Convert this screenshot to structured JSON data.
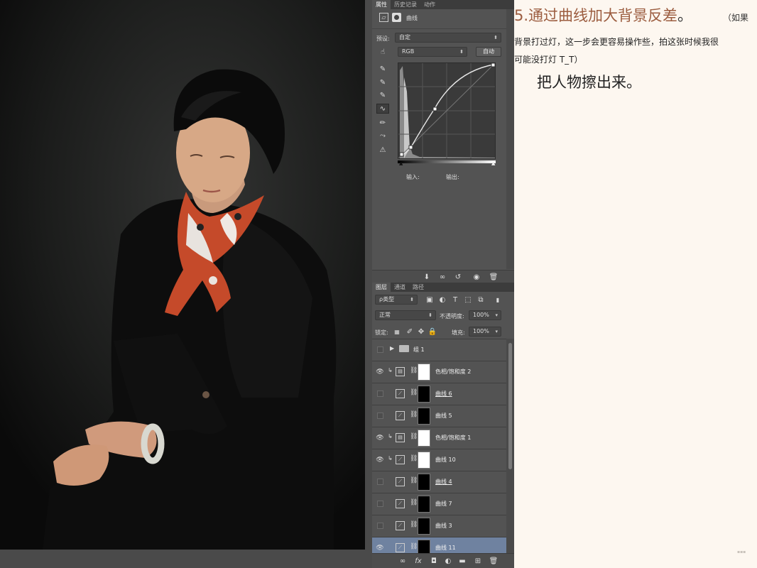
{
  "properties_panel": {
    "tabs": [
      "属性",
      "历史记录",
      "动作"
    ],
    "adjustment_name": "曲线",
    "preset_label": "预设:",
    "preset_value": "自定",
    "channel_value": "RGB",
    "auto_label": "自动",
    "input_label": "输入:",
    "output_label": "输出:"
  },
  "layers_panel": {
    "tabs": [
      "图层",
      "通道",
      "路径"
    ],
    "filter_value": "ρ类型",
    "blend_mode": "正常",
    "opacity_label": "不透明度:",
    "opacity_value": "100%",
    "lock_label": "锁定:",
    "fill_label": "填充:",
    "fill_value": "100%",
    "group_name": "组 1",
    "layers": [
      {
        "name": "色相/饱和度 2",
        "visible": true,
        "type": "hue",
        "mask": "white",
        "clipped": true,
        "underline": false,
        "selected": false
      },
      {
        "name": "曲线 6",
        "visible": false,
        "type": "curves",
        "mask": "black",
        "clipped": false,
        "underline": true,
        "selected": false
      },
      {
        "name": "曲线 5",
        "visible": false,
        "type": "curves",
        "mask": "black",
        "clipped": false,
        "underline": false,
        "selected": false
      },
      {
        "name": "色相/饱和度 1",
        "visible": true,
        "type": "hue",
        "mask": "white",
        "clipped": true,
        "underline": false,
        "selected": false
      },
      {
        "name": "曲线 10",
        "visible": true,
        "type": "curves",
        "mask": "white",
        "clipped": true,
        "underline": false,
        "selected": false
      },
      {
        "name": "曲线 4",
        "visible": false,
        "type": "curves",
        "mask": "black",
        "clipped": false,
        "underline": true,
        "selected": false
      },
      {
        "name": "曲线 7",
        "visible": false,
        "type": "curves",
        "mask": "black",
        "clipped": false,
        "underline": false,
        "selected": false
      },
      {
        "name": "曲线 3",
        "visible": false,
        "type": "curves",
        "mask": "black",
        "clipped": false,
        "underline": false,
        "selected": false
      },
      {
        "name": "曲线 11",
        "visible": true,
        "type": "curves",
        "mask": "black",
        "clipped": false,
        "underline": false,
        "selected": true
      }
    ]
  },
  "tutorial": {
    "heading_number": "5.",
    "heading_text": "通过曲线加大背景反差",
    "heading_mark": "。",
    "note_part_a": "（如果",
    "note_part_b": "背景打过灯，这一步会更容易操作些，拍这张时候我很",
    "note_part_c": "可能没打灯 T_T）",
    "step_text": "把人物擦出来。"
  },
  "colors": {
    "heading": "#9c5d40",
    "panel_bg": "#535353",
    "selected_layer": "#6f82a0",
    "page_bg": "#fdf7f0"
  }
}
